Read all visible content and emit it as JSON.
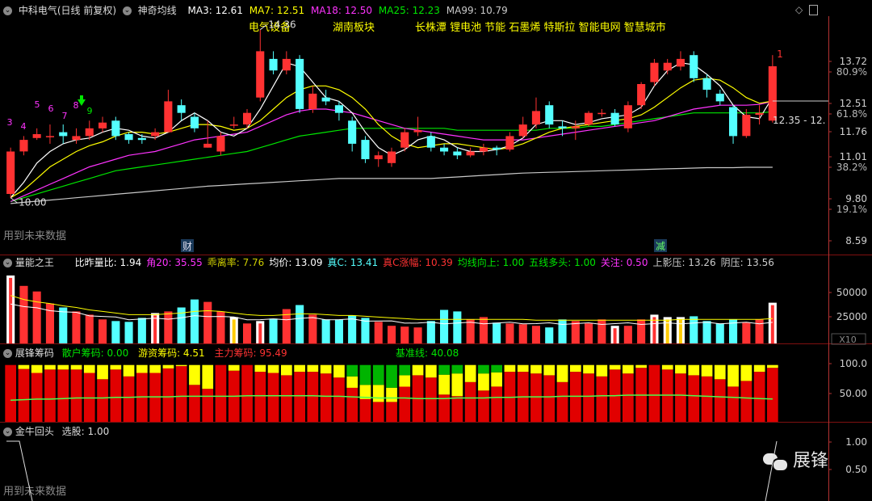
{
  "colors": {
    "bg": "#000000",
    "up": "#ff3232",
    "down": "#54ffff",
    "ma3": "#ffffff",
    "ma7": "#ffff00",
    "ma18": "#ff33ff",
    "ma25": "#00e600",
    "ma99": "#c8c8c8",
    "axis": "#b43232",
    "panelHeader": "#cccccc",
    "chip_retail": "#ffff00",
    "chip_hot": "#00b400",
    "chip_main": "#e10000",
    "baseline": "#4cff4c"
  },
  "main": {
    "stock_title": "中科电气(日线 前复权)",
    "indicator_name": "神奇均线",
    "ma3": "MA3: 12.61",
    "ma7": "MA7: 12.51",
    "ma18": "MA18: 12.50",
    "ma25": "MA25: 12.23",
    "ma99": "MA99: 10.79",
    "tags": [
      "电气设备",
      "湖南板块",
      "长株潭 锂电池 节能 石墨烯 特斯拉 智能电网 智慧城市"
    ],
    "high_label": "14.36",
    "low_label": "10.00",
    "last_label": "1",
    "range_label": "12.35 - 12.",
    "future_note": "用到未来数据",
    "marker_cai": "财",
    "marker_jian": "减",
    "seq_labels": [
      "3",
      "4",
      "5",
      "6",
      "7",
      "8",
      "9"
    ],
    "y_ticks": [
      "13.72",
      "80.9%",
      "12.51",
      "61.8%",
      "11.76",
      "11.01",
      "38.2%",
      "9.80",
      "19.1%",
      "8.59"
    ]
  },
  "volume_panel": {
    "name": "量能之王",
    "items": [
      {
        "label": "比昨量比: 1.94",
        "color": "#ffffff"
      },
      {
        "label": "角20: 35.55",
        "color": "#ff33ff"
      },
      {
        "label": "乖离率: 7.76",
        "color": "#cccc00"
      },
      {
        "label": "均价: 13.09",
        "color": "#ffffff"
      },
      {
        "label": "真C: 13.41",
        "color": "#54ffff"
      },
      {
        "label": "真C涨幅: 10.39",
        "color": "#ff3232"
      },
      {
        "label": "均线向上: 1.00",
        "color": "#00e600"
      },
      {
        "label": "五线多头: 1.00",
        "color": "#00e600"
      },
      {
        "label": "关注: 0.50",
        "color": "#ff33ff"
      },
      {
        "label": "上影压: 13.26",
        "color": "#cccccc"
      },
      {
        "label": "阴压: 13.56",
        "color": "#cccccc"
      }
    ],
    "y_ticks": [
      "50000",
      "25000"
    ],
    "scale_label": "X10"
  },
  "chip_panel": {
    "name": "展锋筹码",
    "items": [
      {
        "label": "散户筹码: 0.00",
        "color": "#00e600"
      },
      {
        "label": "游资筹码: 4.51",
        "color": "#ffff00"
      },
      {
        "label": "主力筹码: 95.49",
        "color": "#ff3232"
      },
      {
        "label": "基准线: 40.08",
        "color": "#00e600"
      }
    ],
    "y_ticks": [
      "100.0",
      "50.00"
    ]
  },
  "bottom_panel": {
    "name": "金牛回头",
    "item": "选股: 1.00",
    "y_ticks": [
      "1.00",
      "0.50"
    ],
    "future_note": "用到未来数据",
    "watermark": "展锋"
  },
  "chart_data": [
    {
      "type": "candlestick",
      "title": "中科电气(日线 前复权)",
      "ylim": [
        8.59,
        14.5
      ],
      "candles": [
        {
          "o": 10.1,
          "c": 11.2,
          "h": 11.3,
          "l": 10.0
        },
        {
          "o": 11.2,
          "c": 11.5,
          "h": 11.6,
          "l": 11.1
        },
        {
          "o": 11.55,
          "c": 11.65,
          "h": 11.8,
          "l": 11.5
        },
        {
          "o": 11.6,
          "c": 11.6,
          "h": 11.9,
          "l": 11.4
        },
        {
          "o": 11.7,
          "c": 11.6,
          "h": 11.9,
          "l": 11.4
        },
        {
          "o": 11.5,
          "c": 11.6,
          "h": 11.8,
          "l": 11.4
        },
        {
          "o": 11.6,
          "c": 11.8,
          "h": 12.0,
          "l": 11.5
        },
        {
          "o": 11.8,
          "c": 11.95,
          "h": 12.1,
          "l": 11.7
        },
        {
          "o": 12.0,
          "c": 11.6,
          "h": 12.1,
          "l": 11.5
        },
        {
          "o": 11.65,
          "c": 11.5,
          "h": 11.7,
          "l": 11.4
        },
        {
          "o": 11.55,
          "c": 11.5,
          "h": 11.65,
          "l": 11.4
        },
        {
          "o": 11.6,
          "c": 11.7,
          "h": 11.8,
          "l": 11.5
        },
        {
          "o": 11.7,
          "c": 12.5,
          "h": 12.8,
          "l": 11.7
        },
        {
          "o": 12.4,
          "c": 12.2,
          "h": 12.55,
          "l": 12.0
        },
        {
          "o": 12.1,
          "c": 11.8,
          "h": 12.2,
          "l": 11.7
        },
        {
          "o": 11.3,
          "c": 11.4,
          "h": 12.0,
          "l": 11.3
        },
        {
          "o": 11.2,
          "c": 11.6,
          "h": 11.7,
          "l": 11.1
        },
        {
          "o": 11.9,
          "c": 11.9,
          "h": 12.1,
          "l": 11.8
        },
        {
          "o": 11.9,
          "c": 12.2,
          "h": 12.3,
          "l": 11.8
        },
        {
          "o": 12.6,
          "c": 13.8,
          "h": 14.36,
          "l": 12.5
        },
        {
          "o": 13.6,
          "c": 13.3,
          "h": 13.8,
          "l": 13.2
        },
        {
          "o": 13.3,
          "c": 13.6,
          "h": 13.8,
          "l": 13.2
        },
        {
          "o": 13.6,
          "c": 12.3,
          "h": 13.7,
          "l": 12.2
        },
        {
          "o": 12.3,
          "c": 12.7,
          "h": 12.9,
          "l": 12.2
        },
        {
          "o": 12.6,
          "c": 12.5,
          "h": 12.8,
          "l": 12.4
        },
        {
          "o": 12.4,
          "c": 12.2,
          "h": 12.5,
          "l": 12.0
        },
        {
          "o": 12.0,
          "c": 11.4,
          "h": 12.1,
          "l": 11.2
        },
        {
          "o": 11.5,
          "c": 11.0,
          "h": 11.6,
          "l": 10.9
        },
        {
          "o": 11.0,
          "c": 11.1,
          "h": 11.2,
          "l": 10.8
        },
        {
          "o": 10.9,
          "c": 11.2,
          "h": 11.3,
          "l": 10.8
        },
        {
          "o": 11.3,
          "c": 11.7,
          "h": 11.8,
          "l": 11.2
        },
        {
          "o": 11.7,
          "c": 11.75,
          "h": 12.1,
          "l": 11.6
        },
        {
          "o": 11.6,
          "c": 11.3,
          "h": 11.7,
          "l": 11.2
        },
        {
          "o": 11.3,
          "c": 11.2,
          "h": 11.4,
          "l": 11.1
        },
        {
          "o": 11.2,
          "c": 11.1,
          "h": 11.3,
          "l": 11.0
        },
        {
          "o": 11.1,
          "c": 11.2,
          "h": 11.3,
          "l": 11.05
        },
        {
          "o": 11.2,
          "c": 11.3,
          "h": 11.4,
          "l": 11.1
        },
        {
          "o": 11.3,
          "c": 11.25,
          "h": 11.35,
          "l": 11.1
        },
        {
          "o": 11.25,
          "c": 11.6,
          "h": 11.7,
          "l": 11.2
        },
        {
          "o": 11.6,
          "c": 11.9,
          "h": 12.1,
          "l": 11.55
        },
        {
          "o": 11.9,
          "c": 12.25,
          "h": 12.6,
          "l": 11.8
        },
        {
          "o": 12.4,
          "c": 11.9,
          "h": 12.5,
          "l": 11.8
        },
        {
          "o": 11.85,
          "c": 11.8,
          "h": 12.0,
          "l": 11.6
        },
        {
          "o": 11.8,
          "c": 11.85,
          "h": 12.0,
          "l": 11.5
        },
        {
          "o": 11.9,
          "c": 12.2,
          "h": 12.25,
          "l": 11.85
        },
        {
          "o": 12.2,
          "c": 12.2,
          "h": 12.3,
          "l": 12.1
        },
        {
          "o": 12.2,
          "c": 11.9,
          "h": 12.3,
          "l": 11.85
        },
        {
          "o": 11.8,
          "c": 12.4,
          "h": 12.5,
          "l": 11.7
        },
        {
          "o": 12.4,
          "c": 12.95,
          "h": 13.0,
          "l": 12.3
        },
        {
          "o": 13.0,
          "c": 13.5,
          "h": 13.6,
          "l": 12.9
        },
        {
          "o": 13.3,
          "c": 13.5,
          "h": 13.6,
          "l": 13.2
        },
        {
          "o": 13.4,
          "c": 13.6,
          "h": 13.8,
          "l": 13.3
        },
        {
          "o": 13.7,
          "c": 13.1,
          "h": 13.8,
          "l": 13.0
        },
        {
          "o": 13.1,
          "c": 12.8,
          "h": 13.2,
          "l": 12.6
        },
        {
          "o": 12.7,
          "c": 12.5,
          "h": 12.8,
          "l": 12.4
        },
        {
          "o": 12.35,
          "c": 11.6,
          "h": 12.4,
          "l": 11.4
        },
        {
          "o": 11.6,
          "c": 12.15,
          "h": 12.3,
          "l": 11.55
        },
        {
          "o": 12.15,
          "c": 12.2,
          "h": 12.4,
          "l": 11.9
        },
        {
          "o": 12.0,
          "c": 13.41,
          "h": 13.7,
          "l": 11.95
        }
      ],
      "ma3": [
        10.0,
        10.4,
        10.9,
        11.2,
        11.4,
        11.5,
        11.55,
        11.7,
        11.8,
        11.75,
        11.6,
        11.55,
        11.7,
        12.0,
        12.2,
        12.0,
        11.7,
        11.6,
        11.8,
        12.3,
        12.9,
        13.5,
        13.4,
        13.0,
        12.6,
        12.5,
        12.2,
        11.7,
        11.3,
        11.1,
        11.25,
        11.5,
        11.6,
        11.5,
        11.3,
        11.2,
        11.2,
        11.25,
        11.35,
        11.55,
        11.9,
        12.0,
        12.0,
        11.9,
        11.95,
        12.05,
        12.1,
        12.15,
        12.35,
        12.9,
        13.3,
        13.5,
        13.45,
        13.2,
        12.9,
        12.4,
        12.1,
        12.05,
        12.61
      ],
      "ma7": [
        10.0,
        10.2,
        10.5,
        10.8,
        11.0,
        11.2,
        11.35,
        11.45,
        11.6,
        11.7,
        11.7,
        11.65,
        11.7,
        11.8,
        11.9,
        11.9,
        11.85,
        11.75,
        11.8,
        12.0,
        12.3,
        12.6,
        12.8,
        12.9,
        12.9,
        12.8,
        12.6,
        12.3,
        11.9,
        11.6,
        11.4,
        11.3,
        11.35,
        11.4,
        11.4,
        11.35,
        11.3,
        11.25,
        11.3,
        11.4,
        11.55,
        11.7,
        11.8,
        11.85,
        11.9,
        11.95,
        12.0,
        12.05,
        12.15,
        12.35,
        12.6,
        12.85,
        13.05,
        13.1,
        13.05,
        12.85,
        12.6,
        12.45,
        12.51
      ],
      "ma18": [
        9.9,
        10.05,
        10.2,
        10.35,
        10.5,
        10.65,
        10.8,
        10.9,
        11.0,
        11.1,
        11.15,
        11.2,
        11.3,
        11.4,
        11.5,
        11.55,
        11.6,
        11.65,
        11.7,
        11.85,
        12.0,
        12.15,
        12.25,
        12.3,
        12.3,
        12.25,
        12.2,
        12.1,
        12.0,
        11.9,
        11.8,
        11.75,
        11.7,
        11.65,
        11.6,
        11.55,
        11.5,
        11.5,
        11.5,
        11.5,
        11.55,
        11.6,
        11.65,
        11.7,
        11.75,
        11.8,
        11.85,
        11.9,
        11.95,
        12.0,
        12.1,
        12.2,
        12.3,
        12.35,
        12.4,
        12.4,
        12.4,
        12.42,
        12.5
      ],
      "ma25": [
        9.9,
        10.0,
        10.1,
        10.2,
        10.3,
        10.4,
        10.5,
        10.6,
        10.7,
        10.75,
        10.8,
        10.85,
        10.9,
        10.95,
        11.0,
        11.05,
        11.1,
        11.15,
        11.2,
        11.3,
        11.4,
        11.5,
        11.6,
        11.65,
        11.7,
        11.75,
        11.8,
        11.8,
        11.8,
        11.8,
        11.8,
        11.8,
        11.8,
        11.8,
        11.75,
        11.75,
        11.75,
        11.75,
        11.75,
        11.75,
        11.75,
        11.8,
        11.8,
        11.8,
        11.85,
        11.85,
        11.9,
        11.95,
        12.0,
        12.05,
        12.1,
        12.15,
        12.2,
        12.2,
        12.2,
        12.2,
        12.2,
        12.2,
        12.23
      ],
      "ma99": [
        9.85,
        9.88,
        9.91,
        9.94,
        9.97,
        10.0,
        10.03,
        10.06,
        10.09,
        10.12,
        10.15,
        10.18,
        10.21,
        10.24,
        10.27,
        10.3,
        10.32,
        10.34,
        10.36,
        10.38,
        10.4,
        10.42,
        10.44,
        10.46,
        10.48,
        10.5,
        10.5,
        10.5,
        10.5,
        10.5,
        10.5,
        10.5,
        10.5,
        10.52,
        10.54,
        10.56,
        10.58,
        10.6,
        10.62,
        10.64,
        10.65,
        10.66,
        10.67,
        10.68,
        10.69,
        10.7,
        10.71,
        10.72,
        10.73,
        10.74,
        10.75,
        10.76,
        10.77,
        10.78,
        10.78,
        10.78,
        10.79,
        10.79,
        10.79
      ]
    },
    {
      "type": "bar",
      "title": "量能之王",
      "values": [
        85,
        72,
        65,
        50,
        45,
        40,
        36,
        30,
        28,
        27,
        32,
        38,
        40,
        45,
        55,
        52,
        40,
        33,
        25,
        28,
        31,
        43,
        48,
        36,
        30,
        30,
        35,
        32,
        27,
        22,
        21,
        20,
        28,
        42,
        40,
        30,
        33,
        26,
        25,
        24,
        22,
        20,
        30,
        28,
        25,
        30,
        22,
        22,
        30,
        36,
        33,
        33,
        34,
        28,
        25,
        30,
        26,
        30,
        51
      ],
      "avg_line": [
        60,
        55,
        52,
        50,
        47,
        45,
        42,
        40,
        38,
        36,
        36,
        36,
        37,
        38,
        40,
        41,
        40,
        38,
        36,
        35,
        35,
        36,
        37,
        37,
        36,
        35,
        35,
        34,
        33,
        32,
        31,
        30,
        30,
        30,
        30,
        30,
        30,
        30,
        30,
        30,
        29,
        29,
        29,
        29,
        29,
        29,
        29,
        29,
        29,
        29,
        29,
        30,
        30,
        30,
        30,
        30,
        30,
        30,
        31
      ]
    },
    {
      "type": "stacked_bar",
      "title": "展锋筹码",
      "segments": [
        "主力筹码",
        "游资筹码",
        "散户筹码"
      ],
      "main": [
        100,
        93,
        86,
        92,
        92,
        92,
        86,
        75,
        92,
        80,
        86,
        86,
        94,
        98,
        65,
        58,
        100,
        90,
        100,
        88,
        86,
        82,
        88,
        88,
        85,
        78,
        60,
        40,
        35,
        35,
        62,
        82,
        78,
        48,
        45,
        70,
        55,
        62,
        88,
        88,
        85,
        82,
        70,
        88,
        85,
        80,
        92,
        85,
        95,
        100,
        92,
        85,
        82,
        80,
        75,
        62,
        72,
        88,
        95
      ],
      "hot": [
        0,
        7,
        14,
        8,
        8,
        8,
        14,
        25,
        8,
        20,
        14,
        14,
        6,
        2,
        35,
        42,
        0,
        10,
        0,
        12,
        14,
        18,
        12,
        12,
        15,
        22,
        20,
        25,
        30,
        25,
        20,
        18,
        22,
        35,
        40,
        30,
        30,
        25,
        12,
        12,
        15,
        18,
        30,
        12,
        15,
        20,
        8,
        15,
        5,
        0,
        8,
        15,
        18,
        20,
        25,
        38,
        28,
        12,
        5
      ],
      "retail": [
        0,
        0,
        0,
        0,
        0,
        0,
        0,
        0,
        0,
        0,
        0,
        0,
        0,
        0,
        0,
        0,
        0,
        0,
        0,
        0,
        0,
        0,
        0,
        0,
        0,
        0,
        20,
        35,
        35,
        40,
        18,
        0,
        0,
        17,
        15,
        0,
        15,
        13,
        0,
        0,
        0,
        0,
        0,
        0,
        0,
        0,
        0,
        0,
        0,
        0,
        0,
        0,
        0,
        0,
        0,
        0,
        0,
        0,
        0
      ],
      "baseline": [
        38,
        39,
        40,
        40,
        41,
        42,
        42,
        42,
        43,
        43,
        44,
        44,
        44,
        45,
        45,
        45,
        45,
        45,
        46,
        46,
        46,
        46,
        46,
        46,
        45,
        45,
        44,
        43,
        42,
        42,
        42,
        41,
        41,
        41,
        42,
        42,
        42,
        43,
        43,
        44,
        44,
        44,
        45,
        45,
        45,
        46,
        46,
        47,
        47,
        47,
        47,
        47,
        46,
        45,
        44,
        43,
        42,
        41,
        40.08
      ]
    },
    {
      "type": "line",
      "title": "金牛回头",
      "ylim": [
        0,
        1
      ],
      "values_left": [
        1,
        0
      ],
      "values_right": [
        0,
        1
      ]
    }
  ]
}
